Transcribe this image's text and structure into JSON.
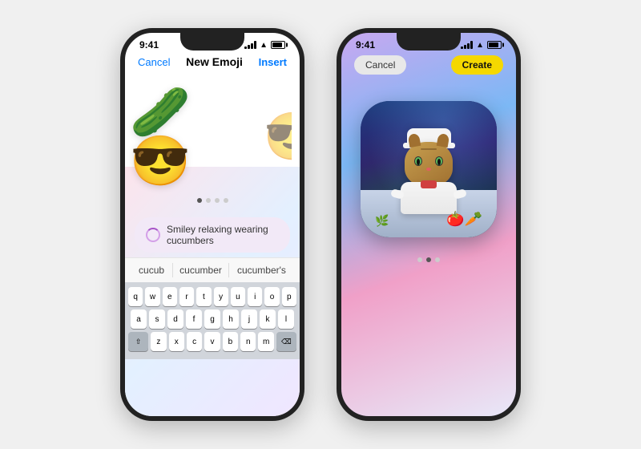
{
  "phone1": {
    "status": {
      "time": "9:41",
      "signal": "wifi",
      "battery": "full"
    },
    "nav": {
      "cancel": "Cancel",
      "title": "New Emoji",
      "insert": "Insert"
    },
    "emojis": [
      "😎🥒",
      "😎🥒"
    ],
    "search": {
      "text": "Smiley relaxing wearing cucumbers"
    },
    "autocomplete": [
      "cucub",
      "cucumber",
      "cucumber's"
    ],
    "keyboard_rows": [
      [
        "q",
        "w",
        "e",
        "r",
        "t",
        "y",
        "u",
        "i",
        "o",
        "p"
      ],
      [
        "a",
        "s",
        "d",
        "f",
        "g",
        "h",
        "j",
        "k",
        "l"
      ],
      [
        "⇧",
        "z",
        "x",
        "c",
        "v",
        "b",
        "n",
        "m",
        "⌫"
      ]
    ],
    "dots": 4,
    "active_dot": 0
  },
  "phone2": {
    "status": {
      "time": "9:41",
      "signal": "wifi",
      "battery": "full"
    },
    "nav": {
      "cancel": "Cancel",
      "create": "Create"
    },
    "dots": 3,
    "active_dot": 1,
    "image_alt": "Chef cat with white hat and red scarf"
  }
}
